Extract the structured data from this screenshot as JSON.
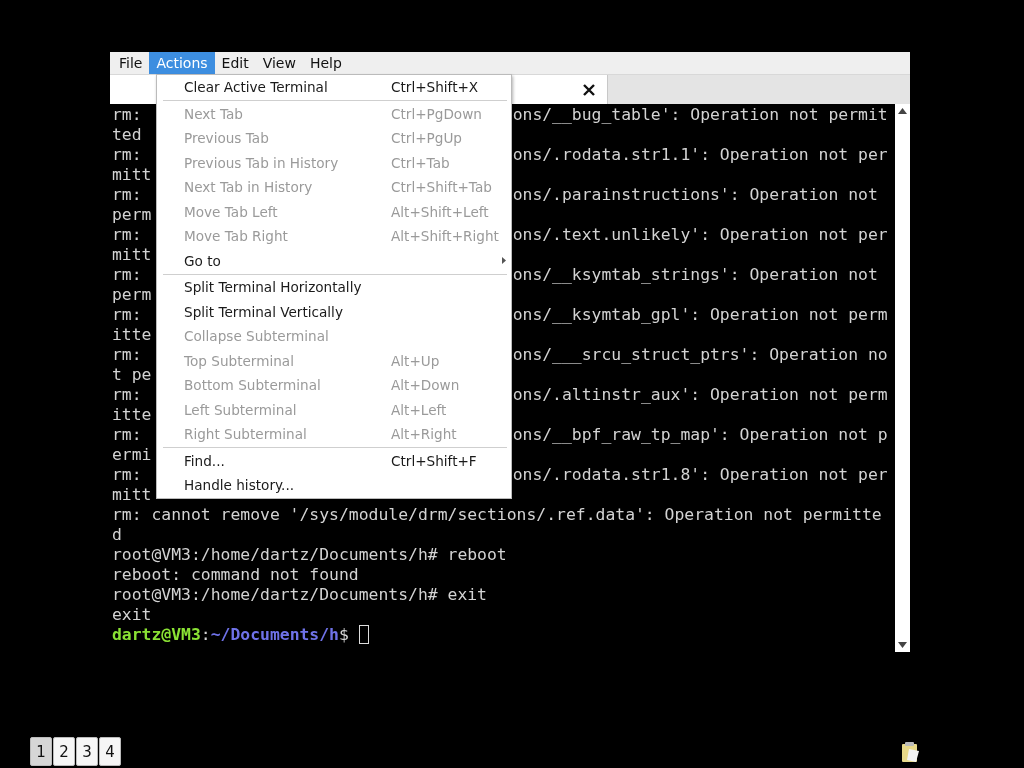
{
  "menu_bar": [
    {
      "label": "File",
      "selected": false
    },
    {
      "label": "Actions",
      "selected": true
    },
    {
      "label": "Edit",
      "selected": false
    },
    {
      "label": "View",
      "selected": false
    },
    {
      "label": "Help",
      "selected": false
    }
  ],
  "tabs": [
    {
      "selected": true
    }
  ],
  "actions_menu": [
    {
      "kind": "item",
      "label": "Clear Active Terminal",
      "shortcut": "Ctrl+Shift+X",
      "disabled": false
    },
    {
      "kind": "separator"
    },
    {
      "kind": "item",
      "label": "Next Tab",
      "shortcut": "Ctrl+PgDown",
      "disabled": true
    },
    {
      "kind": "item",
      "label": "Previous Tab",
      "shortcut": "Ctrl+PgUp",
      "disabled": true
    },
    {
      "kind": "item",
      "label": "Previous Tab in History",
      "shortcut": "Ctrl+Tab",
      "disabled": true
    },
    {
      "kind": "item",
      "label": "Next Tab in History",
      "shortcut": "Ctrl+Shift+Tab",
      "disabled": true
    },
    {
      "kind": "item",
      "label": "Move Tab Left",
      "shortcut": "Alt+Shift+Left",
      "disabled": true
    },
    {
      "kind": "item",
      "label": "Move Tab Right",
      "shortcut": "Alt+Shift+Right",
      "disabled": true
    },
    {
      "kind": "submenu",
      "label": "Go to",
      "disabled": false
    },
    {
      "kind": "separator"
    },
    {
      "kind": "item",
      "label": "Split Terminal Horizontally",
      "disabled": false
    },
    {
      "kind": "item",
      "label": "Split Terminal Vertically",
      "disabled": false
    },
    {
      "kind": "item",
      "label": "Collapse Subterminal",
      "disabled": true
    },
    {
      "kind": "item",
      "label": "Top Subterminal",
      "shortcut": "Alt+Up",
      "disabled": true
    },
    {
      "kind": "item",
      "label": "Bottom Subterminal",
      "shortcut": "Alt+Down",
      "disabled": true
    },
    {
      "kind": "item",
      "label": "Left Subterminal",
      "shortcut": "Alt+Left",
      "disabled": true
    },
    {
      "kind": "item",
      "label": "Right Subterminal",
      "shortcut": "Alt+Right",
      "disabled": true
    },
    {
      "kind": "separator"
    },
    {
      "kind": "item",
      "label": "Find...",
      "shortcut": "Ctrl+Shift+F",
      "disabled": false
    },
    {
      "kind": "item",
      "label": "Handle history...",
      "disabled": false
    }
  ],
  "terminal_lines": [
    {
      "kind": "split",
      "left": "rm:",
      "right": "ons/__bug_table': Operation not permit"
    },
    {
      "kind": "split",
      "left": "ted"
    },
    {
      "kind": "split",
      "left": "rm:",
      "right": "ons/.rodata.str1.1': Operation not per"
    },
    {
      "kind": "split",
      "left": "mitt"
    },
    {
      "kind": "split",
      "left": "rm:",
      "right": "ons/.parainstructions': Operation not"
    },
    {
      "kind": "split",
      "left": "perm"
    },
    {
      "kind": "split",
      "left": "rm:",
      "right": "ons/.text.unlikely': Operation not per"
    },
    {
      "kind": "split",
      "left": "mitt"
    },
    {
      "kind": "split",
      "left": "rm:",
      "right": "ons/__ksymtab_strings': Operation not"
    },
    {
      "kind": "split",
      "left": "perm"
    },
    {
      "kind": "split",
      "left": "rm:",
      "right": "ons/__ksymtab_gpl': Operation not perm"
    },
    {
      "kind": "split",
      "left": "itte"
    },
    {
      "kind": "split",
      "left": "rm:",
      "right": "ons/___srcu_struct_ptrs': Operation no"
    },
    {
      "kind": "split",
      "left": "t pe"
    },
    {
      "kind": "split",
      "left": "rm:",
      "right": "ons/.altinstr_aux': Operation not perm"
    },
    {
      "kind": "split",
      "left": "itte"
    },
    {
      "kind": "split",
      "left": "rm:",
      "right": "ons/__bpf_raw_tp_map': Operation not p"
    },
    {
      "kind": "split",
      "left": "ermi"
    },
    {
      "kind": "split",
      "left": "rm:",
      "right": "ons/.rodata.str1.8': Operation not per"
    },
    {
      "kind": "split",
      "left": "mitt"
    },
    {
      "kind": "text",
      "text": "rm: cannot remove '/sys/module/drm/sections/.ref.data': Operation not permitte"
    },
    {
      "kind": "text",
      "text": "d"
    },
    {
      "kind": "text",
      "text": "root@VM3:/home/dartz/Documents/h# reboot"
    },
    {
      "kind": "text",
      "text": "reboot: command not found"
    },
    {
      "kind": "text",
      "text": "root@VM3:/home/dartz/Documents/h# exit"
    },
    {
      "kind": "text",
      "text": "exit"
    },
    {
      "kind": "prompt",
      "user": "dartz@VM3",
      "separator": ":",
      "path": "~/Documents/h",
      "symbol": "$"
    }
  ],
  "workspaces": [
    {
      "label": "1",
      "selected": true
    },
    {
      "label": "2",
      "selected": false
    },
    {
      "label": "3",
      "selected": false
    },
    {
      "label": "4",
      "selected": false
    }
  ]
}
